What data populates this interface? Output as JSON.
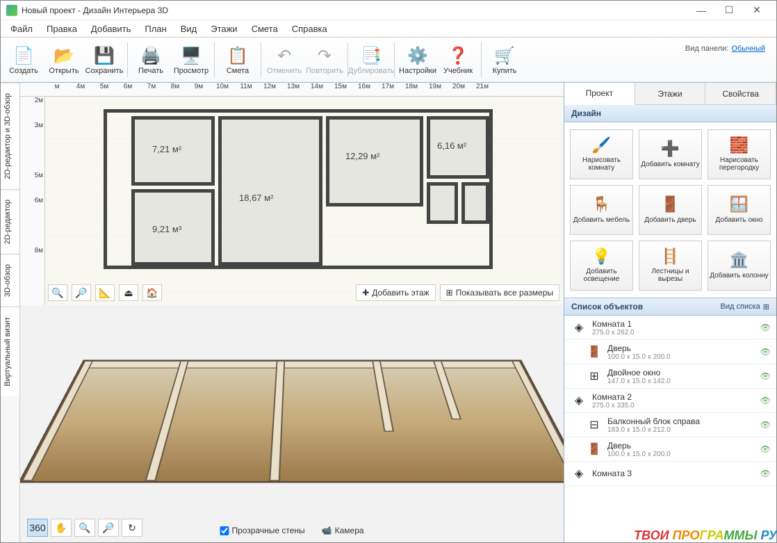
{
  "window": {
    "title": "Новый проект - Дизайн Интерьера 3D"
  },
  "menu": [
    "Файл",
    "Правка",
    "Добавить",
    "План",
    "Вид",
    "Этажи",
    "Смета",
    "Справка"
  ],
  "toolbar": {
    "panel_mode_label": "Вид панели:",
    "panel_mode_value": "Обычный",
    "buttons": [
      {
        "label": "Создать",
        "icon": "📄"
      },
      {
        "label": "Открыть",
        "icon": "📂"
      },
      {
        "label": "Сохранить",
        "icon": "💾"
      },
      {
        "sep": true
      },
      {
        "label": "Печать",
        "icon": "🖨️"
      },
      {
        "label": "Просмотр",
        "icon": "🖥️"
      },
      {
        "sep": true
      },
      {
        "label": "Смета",
        "icon": "📋"
      },
      {
        "sep": true
      },
      {
        "label": "Отменить",
        "icon": "↶",
        "disabled": true
      },
      {
        "label": "Повторить",
        "icon": "↷",
        "disabled": true
      },
      {
        "sep": true
      },
      {
        "label": "Дублировать",
        "icon": "📑",
        "disabled": true
      },
      {
        "sep": true
      },
      {
        "label": "Настройки",
        "icon": "⚙️"
      },
      {
        "label": "Учебник",
        "icon": "❓"
      },
      {
        "sep": true
      },
      {
        "label": "Купить",
        "icon": "🛒"
      }
    ]
  },
  "left_tabs": [
    "2D-редактор и 3D-обзор",
    "2D-редактор",
    "3D-обзор",
    "Виртуальный визит"
  ],
  "ruler_h": [
    "м",
    "4м",
    "5м",
    "6м",
    "7м",
    "8м",
    "9м",
    "10м",
    "11м",
    "12м",
    "13м",
    "14м",
    "15м",
    "16м",
    "17м",
    "18м",
    "19м",
    "20м",
    "21м"
  ],
  "ruler_v": [
    "2м",
    "3м",
    "",
    "5м",
    "6м",
    "",
    "8м"
  ],
  "rooms": [
    {
      "label": "7,21 м²"
    },
    {
      "label": "18,67 м²"
    },
    {
      "label": "12,29 м²"
    },
    {
      "label": "6,16 м²"
    },
    {
      "label": "9,21 м³"
    }
  ],
  "plan_actions": {
    "add_floor": "Добавить этаж",
    "show_sizes": "Показывать все размеры"
  },
  "view3d": {
    "transparent_walls": "Прозрачные стены",
    "camera": "Камера"
  },
  "right": {
    "tabs": [
      "Проект",
      "Этажи",
      "Свойства"
    ],
    "design_title": "Дизайн",
    "tools": [
      {
        "label": "Нарисовать комнату",
        "icon": "🖌️"
      },
      {
        "label": "Добавить комнату",
        "icon": "➕"
      },
      {
        "label": "Нарисовать перегородку",
        "icon": "🧱"
      },
      {
        "label": "Добавить мебель",
        "icon": "🪑"
      },
      {
        "label": "Добавить дверь",
        "icon": "🚪"
      },
      {
        "label": "Добавить окно",
        "icon": "🪟"
      },
      {
        "label": "Добавить освещение",
        "icon": "💡"
      },
      {
        "label": "Лестницы и вырезы",
        "icon": "🪜"
      },
      {
        "label": "Добавить колонну",
        "icon": "🏛️"
      }
    ],
    "list_title": "Список объектов",
    "view_type": "Вид списка",
    "objects": [
      {
        "name": "Комната 1",
        "size": "275.0 x 262.0",
        "icon": "◈",
        "indent": false
      },
      {
        "name": "Дверь",
        "size": "100.0 x 15.0 x 200.0",
        "icon": "🚪",
        "indent": true
      },
      {
        "name": "Двойное окно",
        "size": "147.0 x 15.0 x 142.0",
        "icon": "⊞",
        "indent": true
      },
      {
        "name": "Комната 2",
        "size": "275.0 x 335.0",
        "icon": "◈",
        "indent": false
      },
      {
        "name": "Балконный блок справа",
        "size": "183.0 x 15.0 x 212.0",
        "icon": "⊟",
        "indent": true
      },
      {
        "name": "Дверь",
        "size": "100.0 x 15.0 x 200.0",
        "icon": "🚪",
        "indent": true
      },
      {
        "name": "Комната 3",
        "size": "",
        "icon": "◈",
        "indent": false
      }
    ]
  },
  "watermark": "ТВОИ ПРОГРАММЫ РУ"
}
